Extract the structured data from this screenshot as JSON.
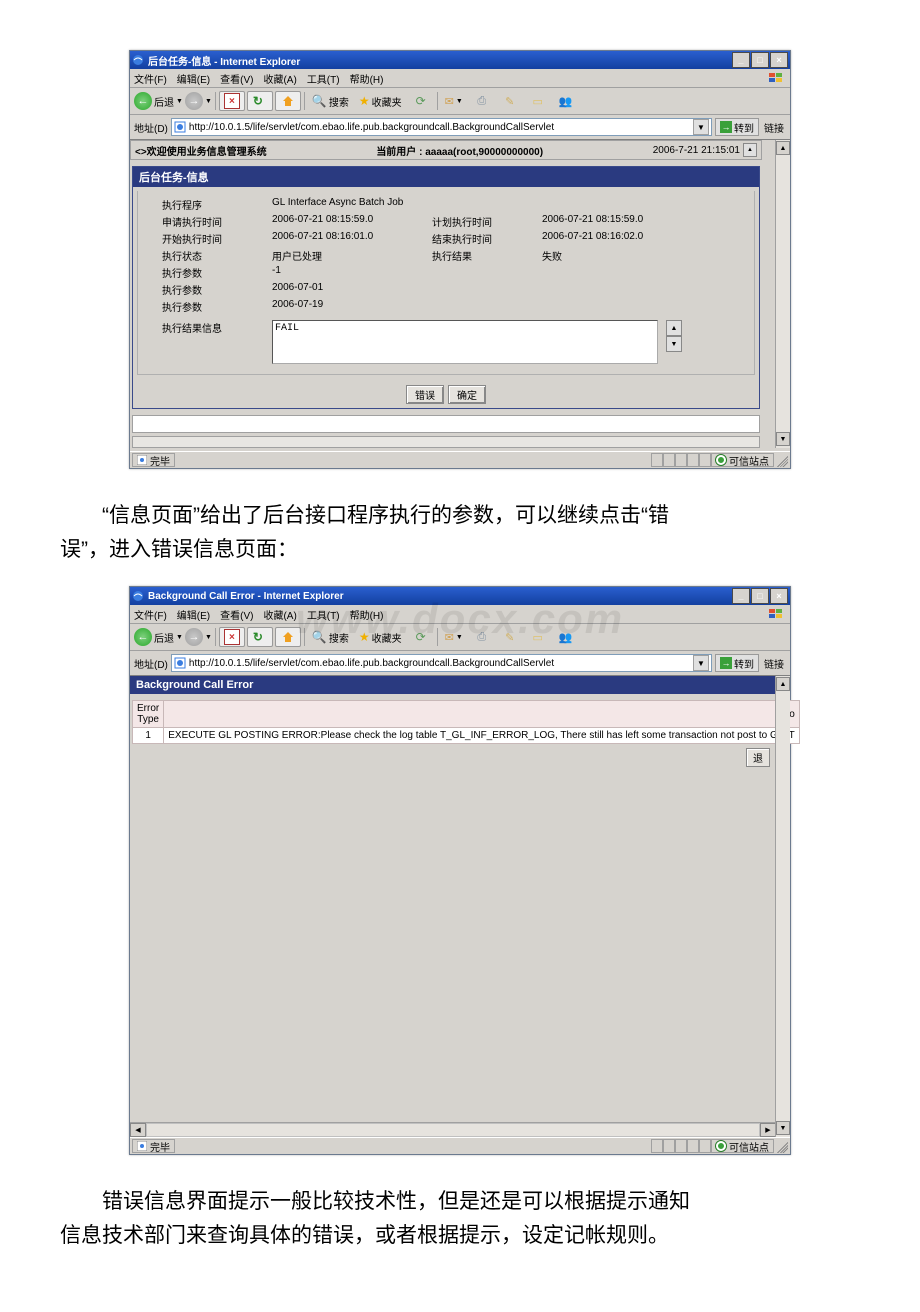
{
  "screenshot1": {
    "window_title": "后台任务-信息 - Internet Explorer",
    "menu": {
      "file": "文件(F)",
      "edit": "编辑(E)",
      "view": "查看(V)",
      "fav": "收藏(A)",
      "tools": "工具(T)",
      "help": "帮助(H)"
    },
    "toolbar": {
      "back": "后退",
      "search": "搜索",
      "favorites": "收藏夹"
    },
    "addr": {
      "label": "地址(D)",
      "url": "http://10.0.1.5/life/servlet/com.ebao.life.pub.backgroundcall.BackgroundCallServlet",
      "go": "转到",
      "links": "链接"
    },
    "sysbar": {
      "left": "<>欢迎使用业务信息管理系统",
      "mid": "当前用户 : aaaaa(root,90000000000)",
      "right": "2006-7-21 21:15:01"
    },
    "panel_title": "后台任务-信息",
    "details": {
      "rows": [
        {
          "l1": "执行程序",
          "v1": "GL Interface Async Batch Job",
          "l2": "",
          "v2": ""
        },
        {
          "l1": "申请执行时间",
          "v1": "2006-07-21 08:15:59.0",
          "l2": "计划执行时间",
          "v2": "2006-07-21 08:15:59.0"
        },
        {
          "l1": "开始执行时间",
          "v1": "2006-07-21 08:16:01.0",
          "l2": "结束执行时间",
          "v2": "2006-07-21 08:16:02.0"
        },
        {
          "l1": "执行状态",
          "v1": "用户已处理",
          "l2": "执行结果",
          "v2": "失败"
        },
        {
          "l1": "执行参数",
          "v1": "-1",
          "l2": "",
          "v2": ""
        },
        {
          "l1": "执行参数",
          "v1": "2006-07-01",
          "l2": "",
          "v2": ""
        },
        {
          "l1": "执行参数",
          "v1": "2006-07-19",
          "l2": "",
          "v2": ""
        }
      ],
      "result_label": "执行结果信息",
      "result_text": "FAIL"
    },
    "buttons": {
      "error": "错误",
      "ok": "确定"
    },
    "status": {
      "done": "完毕",
      "zone": "可信站点"
    }
  },
  "paragraph1_a": "“信息页面”给出了后台接口程序执行的参数，可以继续点击“错",
  "paragraph1_b": "误”，进入错误信息页面：",
  "screenshot2": {
    "window_title": "Background Call Error - Internet Explorer",
    "menu": {
      "file": "文件(F)",
      "edit": "编辑(E)",
      "view": "查看(V)",
      "fav": "收藏(A)",
      "tools": "工具(T)",
      "help": "帮助(H)"
    },
    "toolbar": {
      "back": "后退",
      "search": "搜索",
      "favorites": "收藏夹"
    },
    "addr": {
      "label": "地址(D)",
      "url": "http://10.0.1.5/life/servlet/com.ebao.life.pub.backgroundcall.BackgroundCallServlet",
      "go": "转到",
      "links": "链接"
    },
    "panel_title": "Background Call Error",
    "table": {
      "col_errortype": "Error Type",
      "col_info": "Info",
      "row1_type": "1",
      "row1_info": "EXECUTE GL  POSTING ERROR:Please check the log table T_GL_INF_ERROR_LOG,  There still has left some transaction not post to GL,  T"
    },
    "back_btn": "退",
    "status": {
      "done": "完毕",
      "zone": "可信站点"
    }
  },
  "paragraph2_a": "错误信息界面提示一般比较技术性，但是还是可以根据提示通知",
  "paragraph2_b": "信息技术部门来查询具体的错误，或者根据提示，设定记帐规则。",
  "watermark": "www.docx.com"
}
